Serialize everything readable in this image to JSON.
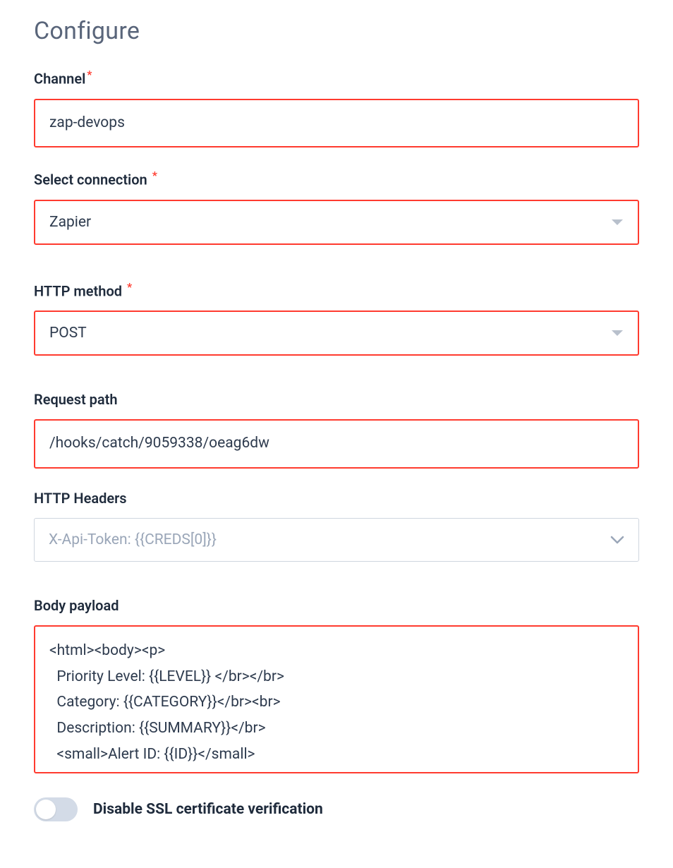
{
  "page_title": "Configure",
  "channel": {
    "label": "Channel",
    "required": "*",
    "value": "zap-devops"
  },
  "connection": {
    "label": "Select connection",
    "required": "*",
    "value": "Zapier"
  },
  "http_method": {
    "label": "HTTP method",
    "required": "*",
    "value": "POST"
  },
  "request_path": {
    "label": "Request path",
    "value": "/hooks/catch/9059338/oeag6dw"
  },
  "http_headers": {
    "label": "HTTP Headers",
    "placeholder": "X-Api-Token: {{CREDS[0]}}"
  },
  "body_payload": {
    "label": "Body payload",
    "value": "<html><body><p>\n  Priority Level: {{LEVEL}} </br></br>\n  Category: {{CATEGORY}}</br><br>\n  Description: {{SUMMARY}}</br>\n  <small>Alert ID: {{ID}}</small>"
  },
  "ssl_toggle": {
    "label": "Disable SSL certificate verification"
  }
}
